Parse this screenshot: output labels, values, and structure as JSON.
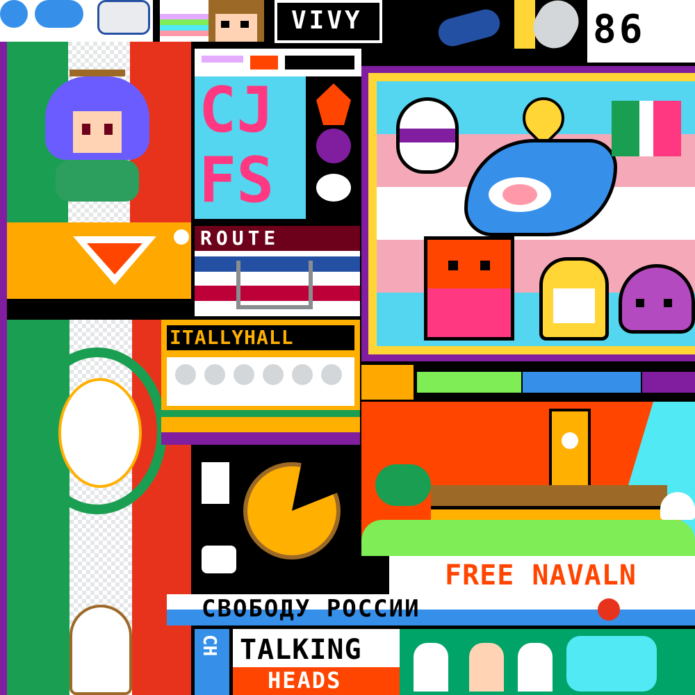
{
  "canvas": {
    "background": "#000000"
  },
  "colors": {
    "green": "#1a9e52",
    "red": "#e8331c",
    "orange": "#ff4500",
    "yellow": "#ffb000",
    "cyan": "#54d6f0",
    "pink": "#f5a9b8",
    "purple": "#811e9f",
    "blue": "#2450a4",
    "white": "#ffffff",
    "black": "#000000"
  },
  "texts": {
    "vivy": "VIVY",
    "counter": "86",
    "italy_hall": "ITALLYHALL",
    "free_navalny": "FREE NAVALN",
    "svobodu": "СВОБОДУ РОССИИ",
    "talking": "TALKING",
    "heads": "HEADS",
    "cjfs_top": "CJ",
    "cjfs_bottom": "FS",
    "ch": "CH",
    "rounded_header": "ROUTE"
  },
  "icons": [
    "anime-girl-icon",
    "shark-icon",
    "cat-icon",
    "slime-icon",
    "heart-icon",
    "egg-icon",
    "pizza-icon",
    "wreath-icon",
    "clock-tower-icon",
    "palm-tree-icon",
    "mushroom-icon"
  ]
}
